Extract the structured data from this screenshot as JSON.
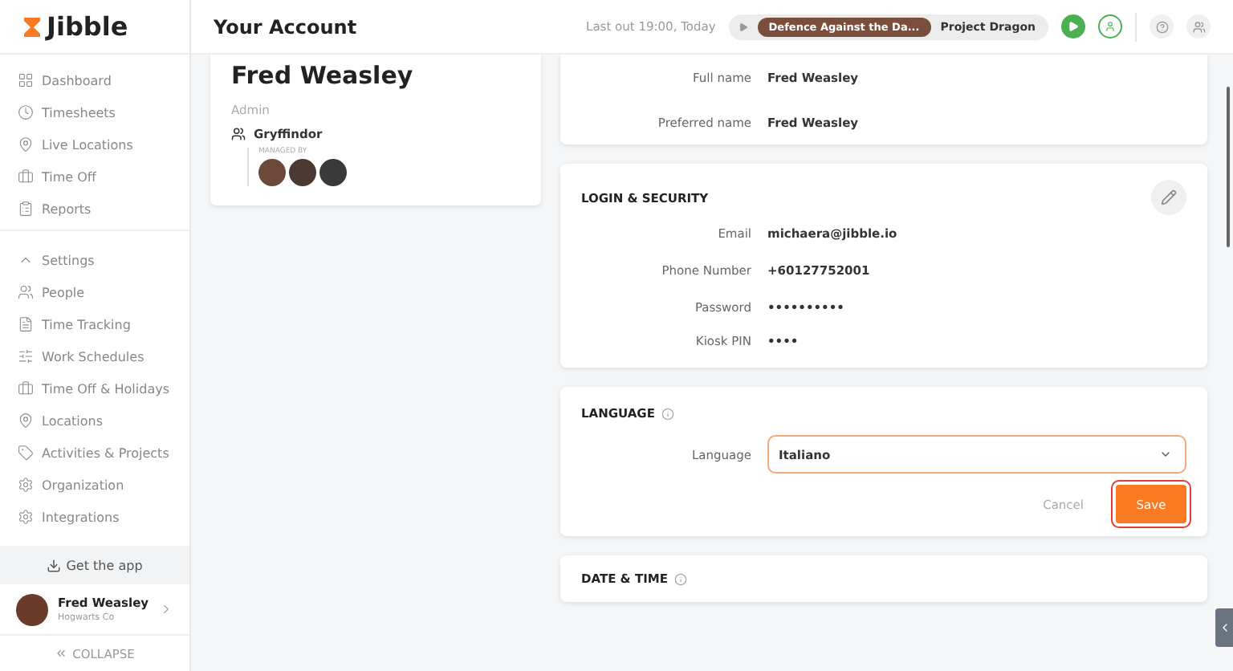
{
  "brand": {
    "name": "Jibble"
  },
  "header": {
    "title": "Your Account",
    "last_out": "Last out 19:00, Today",
    "activity": "Defence Against the Da...",
    "project": "Project Dragon"
  },
  "sidebar": {
    "items": [
      {
        "label": "Dashboard",
        "kind": "item"
      },
      {
        "label": "Timesheets",
        "kind": "item"
      },
      {
        "label": "Live Locations",
        "kind": "item"
      },
      {
        "label": "Time Off",
        "kind": "item"
      },
      {
        "label": "Reports",
        "kind": "item"
      },
      {
        "label": "Settings",
        "kind": "group"
      },
      {
        "label": "People",
        "kind": "item"
      },
      {
        "label": "Time Tracking",
        "kind": "item"
      },
      {
        "label": "Work Schedules",
        "kind": "item"
      },
      {
        "label": "Time Off & Holidays",
        "kind": "item"
      },
      {
        "label": "Locations",
        "kind": "item"
      },
      {
        "label": "Activities & Projects",
        "kind": "item"
      },
      {
        "label": "Organization",
        "kind": "item"
      },
      {
        "label": "Integrations",
        "kind": "item"
      }
    ],
    "get_app": "Get the app",
    "user": {
      "name": "Fred Weasley",
      "org": "Hogwarts Co"
    },
    "collapse": "COLLAPSE"
  },
  "profile": {
    "name": "Fred Weasley",
    "role": "Admin",
    "group": "Gryffindor",
    "managed_by": "MANAGED BY"
  },
  "name_card": {
    "fields": [
      {
        "label": "Full name",
        "value": "Fred Weasley"
      },
      {
        "label": "Preferred name",
        "value": "Fred Weasley"
      }
    ]
  },
  "login_security": {
    "title": "LOGIN & SECURITY",
    "fields": [
      {
        "label": "Email",
        "value": "michaera@jibble.io"
      },
      {
        "label": "Phone Number",
        "value": "+60127752001"
      },
      {
        "label": "Password",
        "value": "••••••••••"
      },
      {
        "label": "Kiosk PIN",
        "value": "••••"
      }
    ]
  },
  "language": {
    "title": "LANGUAGE",
    "label": "Language",
    "value": "Italiano",
    "cancel": "Cancel",
    "save": "Save"
  },
  "date_time": {
    "title": "DATE & TIME"
  }
}
